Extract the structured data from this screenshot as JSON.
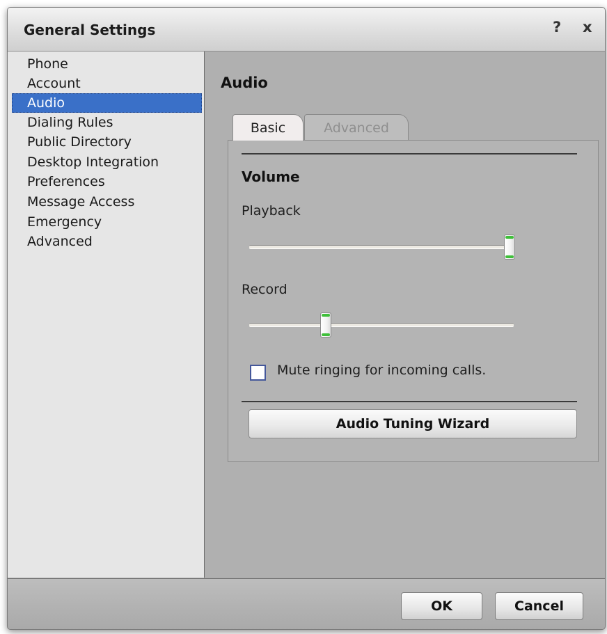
{
  "window": {
    "title": "General Settings",
    "help_label": "?",
    "close_label": "x"
  },
  "nav": {
    "items": [
      {
        "label": "Phone"
      },
      {
        "label": "Account"
      },
      {
        "label": "Audio",
        "selected": true
      },
      {
        "label": "Dialing Rules"
      },
      {
        "label": "Public Directory"
      },
      {
        "label": "Desktop Integration"
      },
      {
        "label": "Preferences"
      },
      {
        "label": "Message Access"
      },
      {
        "label": "Emergency"
      },
      {
        "label": "Advanced"
      }
    ]
  },
  "content": {
    "section_title": "Audio",
    "tabs": [
      {
        "label": "Basic",
        "active": true
      },
      {
        "label": "Advanced",
        "active": false
      }
    ],
    "volume": {
      "title": "Volume",
      "playback_label": "Playback",
      "playback_level": 1.0,
      "record_label": "Record",
      "record_level": 0.29
    },
    "mute_ringing": {
      "label": "Mute ringing for incoming calls.",
      "checked": false
    },
    "wizard_button": "Audio Tuning Wizard"
  },
  "footer": {
    "ok": "OK",
    "cancel": "Cancel"
  },
  "colors": {
    "selection": "#3a70c8",
    "slider_accent": "#3fbf3a",
    "checkbox_border": "#44579a"
  }
}
